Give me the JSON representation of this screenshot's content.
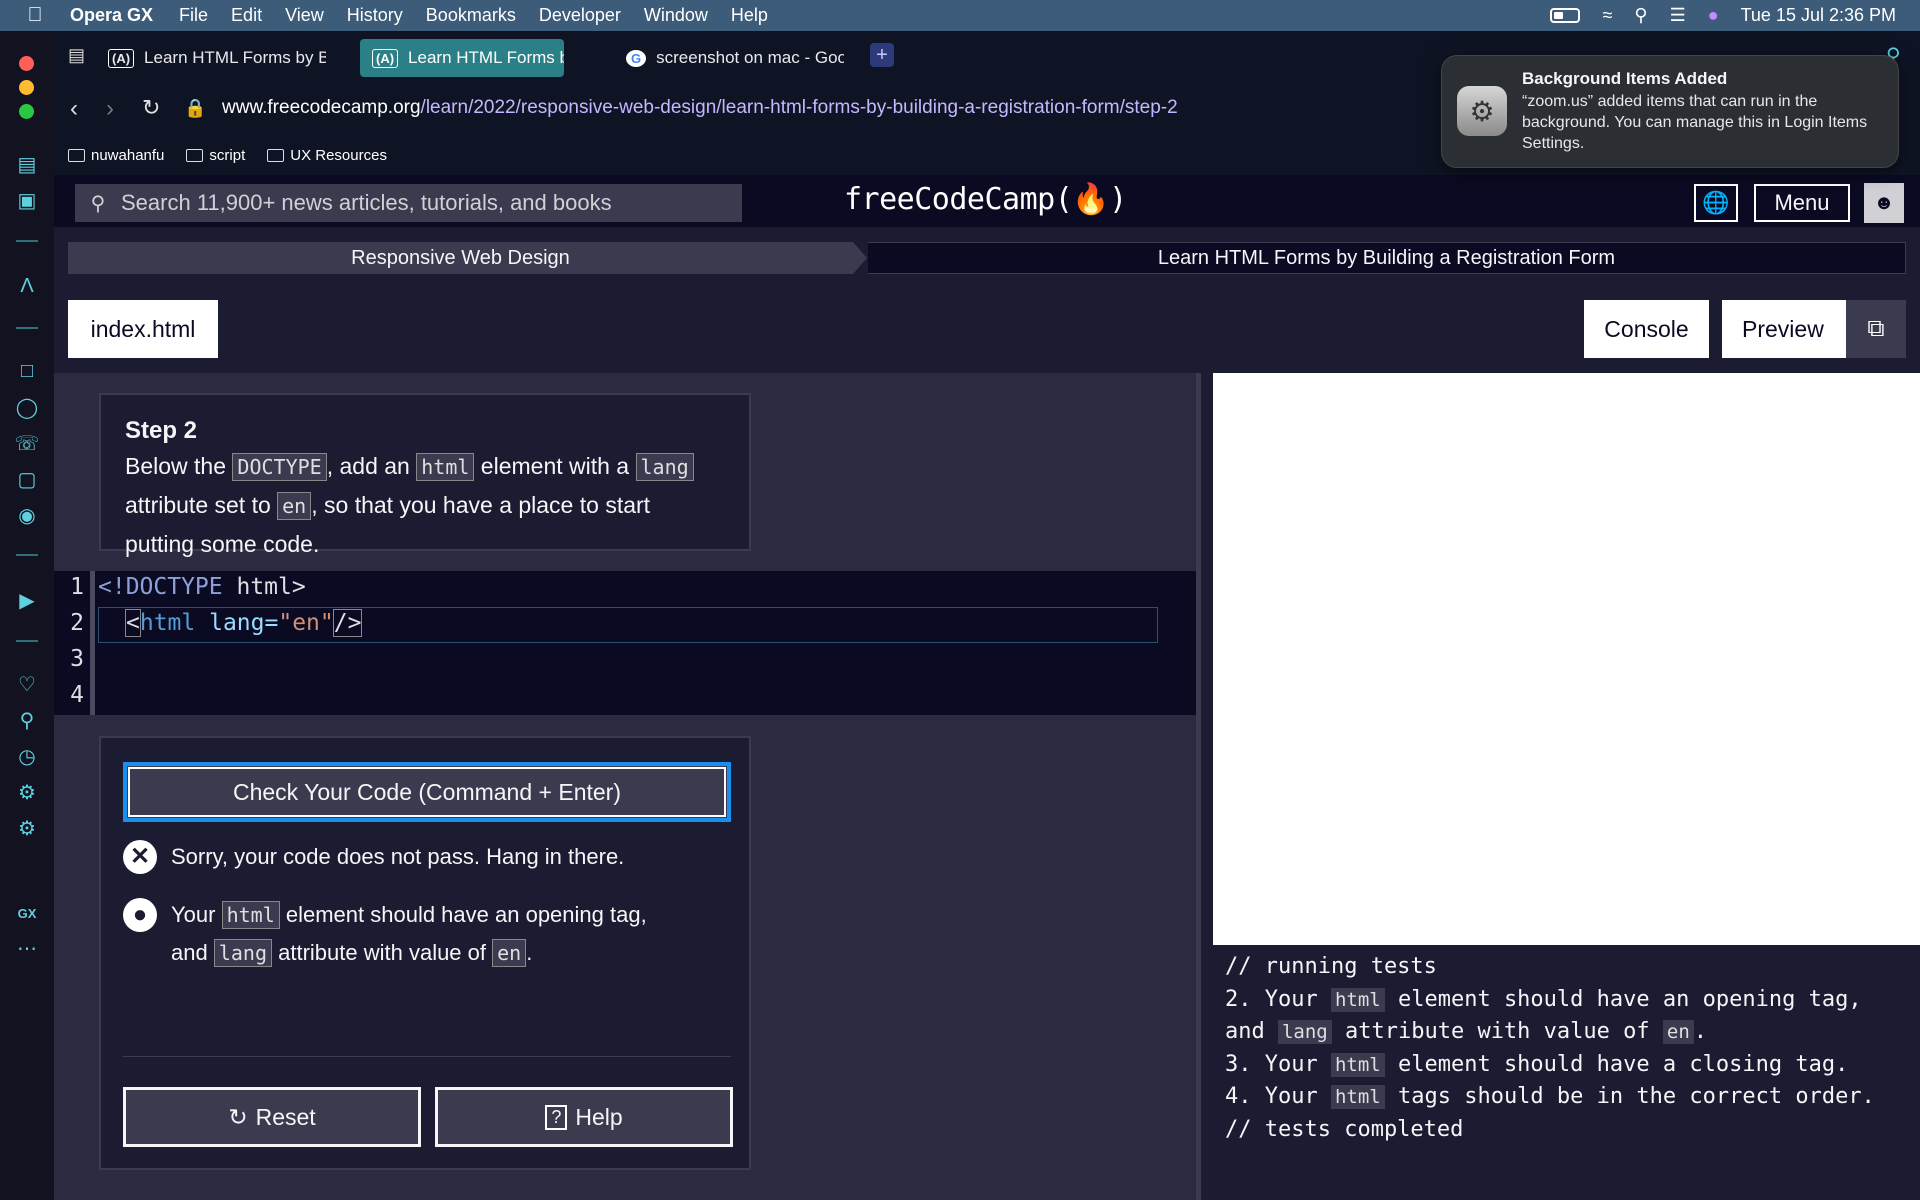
{
  "os_menubar": {
    "app": "Opera GX",
    "items": [
      "File",
      "Edit",
      "View",
      "History",
      "Bookmarks",
      "Developer",
      "Window",
      "Help"
    ],
    "clock": "Tue 15 Jul  2:36 PM"
  },
  "tabs": [
    {
      "label": "Learn HTML Forms by Bui",
      "fav": "(A)"
    },
    {
      "label": "Learn HTML Forms by Bu",
      "fav": "(A)"
    },
    {
      "label": "screenshot on mac - Goo",
      "fav": "G"
    }
  ],
  "address": {
    "host": "www.freecodecamp.org",
    "path": "/learn/2022/responsive-web-design/learn-html-forms-by-building-a-registration-form/step-2"
  },
  "bookmarks": [
    "nuwahanfu",
    "script",
    "UX Resources"
  ],
  "notification": {
    "title": "Background Items Added",
    "body": "“zoom.us” added items that can run in the background. You can manage this in Login Items Settings."
  },
  "fcc_nav": {
    "search_placeholder": "Search 11,900+ news articles, tutorials, and books",
    "logo": "freeCodeCamp(🔥)",
    "menu": "Menu"
  },
  "breadcrumbs": [
    "Responsive Web Design",
    "Learn HTML Forms by Building a Registration Form"
  ],
  "toolbar": {
    "file_tab": "index.html",
    "console": "Console",
    "preview": "Preview"
  },
  "step": {
    "title": "Step 2",
    "p1": "Below the ",
    "c1": "DOCTYPE",
    "p2": ", add an ",
    "c2": "html",
    "p3": " element with a ",
    "c3": "lang",
    "p4": " attribute set to ",
    "c4": "en",
    "p5": ", so that you have a place to start putting some code."
  },
  "editor": {
    "line_numbers": [
      "1",
      "2",
      "3",
      "4"
    ],
    "line1_kw": "<!DOCTYPE",
    "line1_rest": " html>",
    "line2_open": "<",
    "line2_tag": "html",
    "line2_attr": " lang=",
    "line2_val": "\"en\"",
    "line2_close": "/>"
  },
  "actions": {
    "check": "Check Your Code (Command + Enter)",
    "fail_msg": "Sorry, your code does not pass. Hang in there.",
    "hint_a": "Your ",
    "hint_c1": "html",
    "hint_b": " element should have an opening tag, and ",
    "hint_c2": "lang",
    "hint_c": " attribute with value of ",
    "hint_c3": "en",
    "hint_d": ".",
    "reset": "Reset",
    "help": "Help"
  },
  "console": {
    "l1": "// running tests",
    "l2a": "2. Your ",
    "l2c": "html",
    "l2b": " element should have an opening tag,",
    "l3a": "and ",
    "l3c": "lang",
    "l3b": " attribute with value of ",
    "l3c2": "en",
    "l3d": ".",
    "l4a": "3. Your ",
    "l4c": "html",
    "l4b": " element should have a closing tag.",
    "l5a": "4. Your ",
    "l5c": "html",
    "l5b": " tags should be in the correct order.",
    "l6": "// tests completed"
  },
  "colors": {
    "fcc_bg": "#0a0a23",
    "panel": "#1b1b32",
    "accent_tab": "#2b7f86",
    "focus": "#198eee"
  }
}
